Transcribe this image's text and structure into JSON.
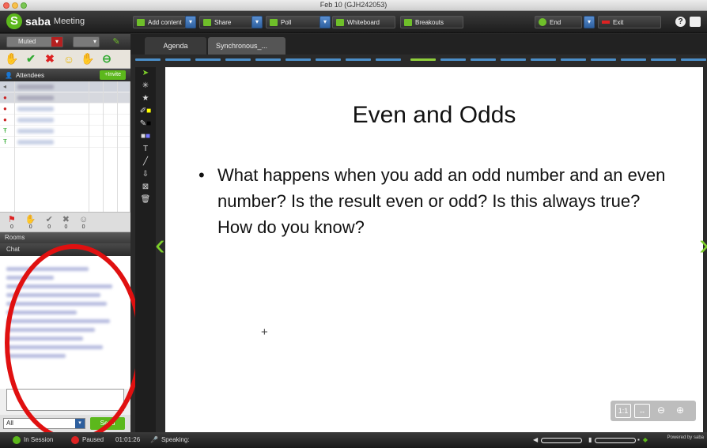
{
  "window": {
    "title": "Feb 10 (GJH242053)"
  },
  "brand": {
    "name": "saba",
    "product": "Meeting"
  },
  "toolbar": {
    "add_content": "Add content",
    "share": "Share",
    "poll": "Poll",
    "whiteboard": "Whiteboard",
    "breakouts": "Breakouts",
    "end": "End",
    "exit": "Exit"
  },
  "audio": {
    "muted_label": "Muted"
  },
  "attendees": {
    "header": "Attendees",
    "invite_label": "+Invite"
  },
  "status_counts": [
    "0",
    "0",
    "0",
    "0",
    "0"
  ],
  "rooms": {
    "label": "Rooms"
  },
  "chat": {
    "header": "Chat",
    "recipient": "All",
    "send_label": "Send"
  },
  "tabs": [
    {
      "label": "Agenda"
    },
    {
      "label": "Synchronous_..."
    }
  ],
  "slide": {
    "title": "Even and Odds",
    "bullet": "What happens when you add an odd number and an even number?  Is the result even or odd? Is this always true?  How do you know?"
  },
  "statusbar": {
    "session": "In Session",
    "paused": "Paused",
    "time": "01:01:26",
    "speaking": "Speaking:",
    "powered_by": "Powered by saba"
  },
  "colors": {
    "accent_green": "#5cb81c",
    "highlight_red": "#e01010",
    "segment_blue": "#4b8fc9"
  }
}
